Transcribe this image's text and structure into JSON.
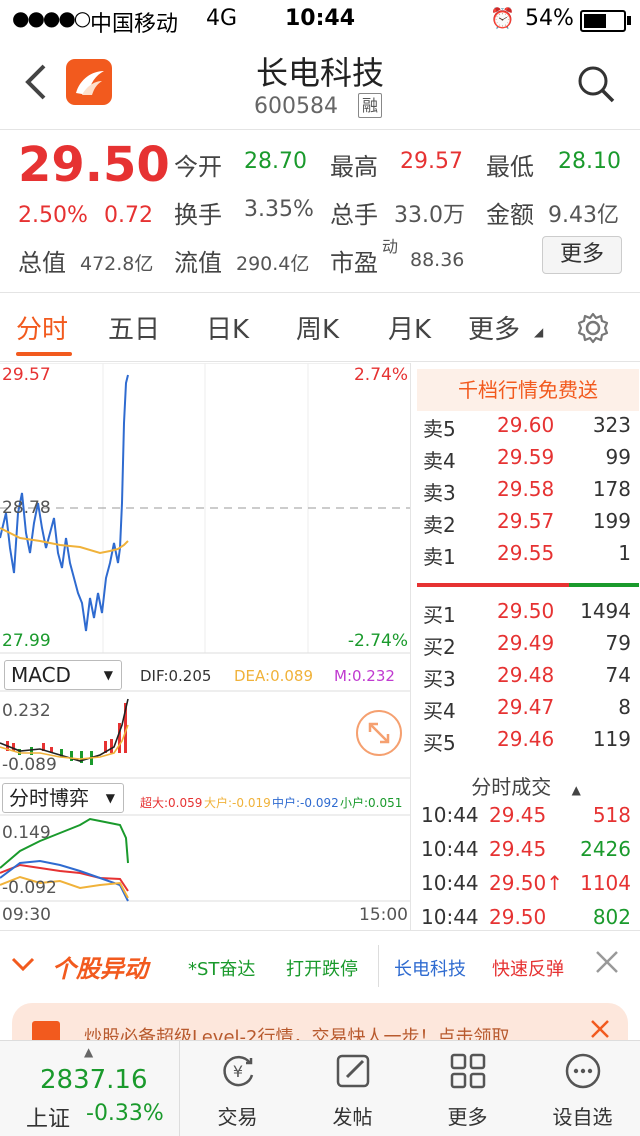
{
  "status_bar": {
    "signal": "●●●●○",
    "carrier": "中国移动",
    "network": "4G",
    "time": "10:44",
    "battery": "54%"
  },
  "header": {
    "title": "长电科技",
    "code": "600584",
    "rong_badge": "融"
  },
  "quote": {
    "price": "29.50",
    "change_pct": "2.50%",
    "change": "0.72",
    "fields": [
      {
        "label": "今开",
        "value": "28.70",
        "color": "green"
      },
      {
        "label": "最高",
        "value": "29.57",
        "color": "red"
      },
      {
        "label": "最低",
        "value": "28.10",
        "color": "green"
      },
      {
        "label": "换手",
        "value": "3.35%",
        "color": "grey"
      },
      {
        "label": "总手",
        "value": "33.0万",
        "color": "grey"
      },
      {
        "label": "金额",
        "value": "9.43亿",
        "color": "grey"
      },
      {
        "label": "总值",
        "value": "472.8亿",
        "color": "grey"
      },
      {
        "label": "流值",
        "value": "290.4亿",
        "color": "grey"
      },
      {
        "label": "市盈",
        "value": "88.36",
        "color": "grey"
      }
    ],
    "pe_superscript": "动",
    "more_button": "更多"
  },
  "tabs": [
    {
      "label": "分时",
      "active": true
    },
    {
      "label": "五日"
    },
    {
      "label": "日K"
    },
    {
      "label": "周K"
    },
    {
      "label": "月K"
    },
    {
      "label": "更多"
    }
  ],
  "chart": {
    "high_price": "29.57",
    "high_pct": "2.74%",
    "mid_price": "28.78",
    "low_price": "27.99",
    "low_pct": "-2.74%",
    "macd": {
      "selector": "MACD",
      "dif_label": "DIF:0.205",
      "dea_label": "DEA:0.089",
      "m_label": "M:0.232",
      "top": "0.232",
      "bottom": "-0.089"
    },
    "game": {
      "selector": "分时博弈",
      "big": "超大:0.059",
      "large": "大户:-0.019",
      "mid": "中户:-0.092",
      "small": "小户:0.051",
      "top": "0.149",
      "bottom": "-0.092"
    },
    "time_start": "09:30",
    "time_end": "15:00"
  },
  "order_book": {
    "banner": "千档行情免费送",
    "asks": [
      {
        "label": "卖5",
        "price": "29.60",
        "vol": "323"
      },
      {
        "label": "卖4",
        "price": "29.59",
        "vol": "99"
      },
      {
        "label": "卖3",
        "price": "29.58",
        "vol": "178"
      },
      {
        "label": "卖2",
        "price": "29.57",
        "vol": "199"
      },
      {
        "label": "卖1",
        "price": "29.55",
        "vol": "1"
      }
    ],
    "bids": [
      {
        "label": "买1",
        "price": "29.50",
        "vol": "1494"
      },
      {
        "label": "买2",
        "price": "29.49",
        "vol": "79"
      },
      {
        "label": "买3",
        "price": "29.48",
        "vol": "74"
      },
      {
        "label": "买4",
        "price": "29.47",
        "vol": "8"
      },
      {
        "label": "买5",
        "price": "29.46",
        "vol": "119"
      }
    ],
    "ticks_title": "分时成交",
    "ticks": [
      {
        "time": "10:44",
        "price": "29.45",
        "vol": "518",
        "color": "red"
      },
      {
        "time": "10:44",
        "price": "29.45",
        "vol": "2426",
        "color": "green"
      },
      {
        "time": "10:44",
        "price": "29.50↑",
        "vol": "1104",
        "color": "red"
      },
      {
        "time": "10:44",
        "price": "29.50",
        "vol": "802",
        "color": "green"
      }
    ]
  },
  "alert": {
    "title": "个股异动",
    "items": [
      "*ST奋达",
      "打开跌停",
      "长电科技",
      "快速反弹"
    ]
  },
  "promo": "炒股必备超级Level-2行情，交易快人一步！点击领取",
  "bottom_bar": {
    "index_value": "2837.16",
    "index_name": "上证",
    "index_change": "-0.33%",
    "items": [
      "交易",
      "发帖",
      "更多",
      "设自选"
    ]
  },
  "colors": {
    "accent": "#f25a1e",
    "up": "#e63232",
    "down": "#1a9a2c"
  }
}
